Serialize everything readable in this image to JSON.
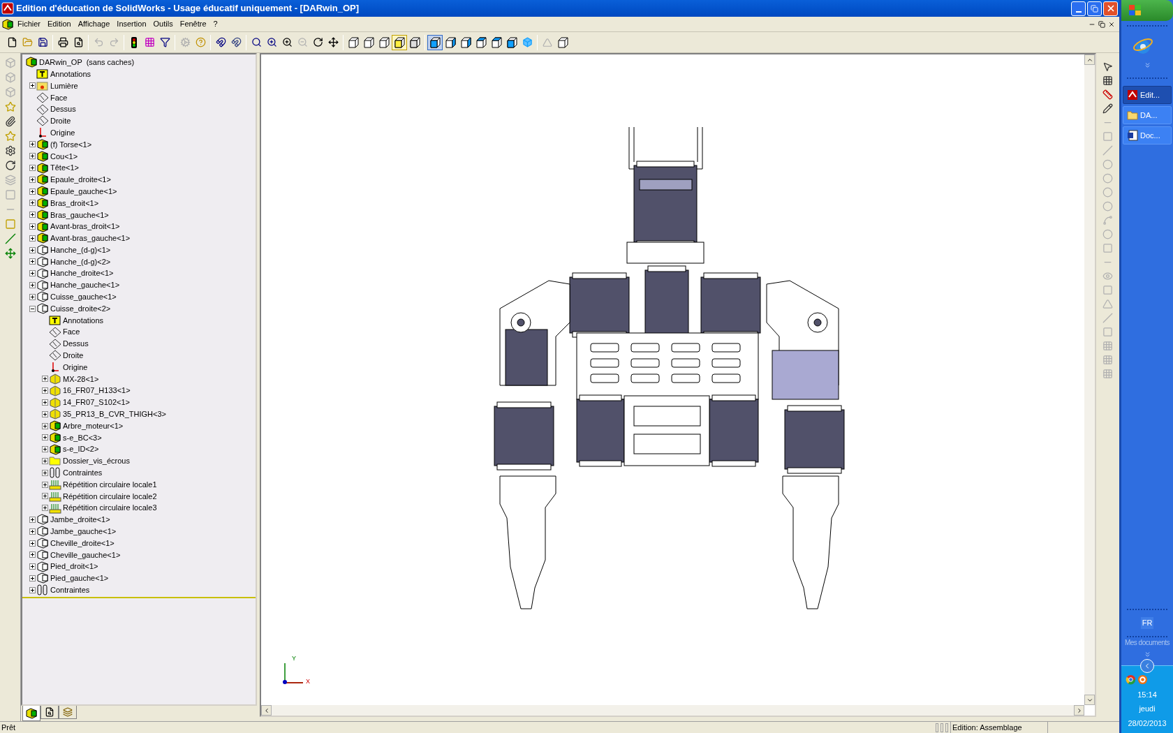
{
  "window": {
    "title": "Edition d'éducation de SolidWorks - Usage éducatif uniquement - [DARwin_OP]"
  },
  "menu": [
    "Fichier",
    "Edition",
    "Affichage",
    "Insertion",
    "Outils",
    "Fenêtre",
    "?"
  ],
  "tree": {
    "label": "DARwin_OP  (sans caches)",
    "kind": "assembly-fixed",
    "children": [
      {
        "label": "Annotations",
        "kind": "annotations"
      },
      {
        "label": "Lumière",
        "kind": "light",
        "expanded": false
      },
      {
        "label": "Face",
        "kind": "plane"
      },
      {
        "label": "Dessus",
        "kind": "plane"
      },
      {
        "label": "Droite",
        "kind": "plane"
      },
      {
        "label": "Origine",
        "kind": "origin"
      },
      {
        "label": "(f) Torse<1>",
        "kind": "assembly-fixed",
        "expanded": false
      },
      {
        "label": "Cou<1>",
        "kind": "assembly-fixed",
        "expanded": false
      },
      {
        "label": "Tête<1>",
        "kind": "assembly-fixed",
        "expanded": false
      },
      {
        "label": "Epaule_droite<1>",
        "kind": "assembly-fixed",
        "expanded": false
      },
      {
        "label": "Epaule_gauche<1>",
        "kind": "assembly-fixed",
        "expanded": false
      },
      {
        "label": "Bras_droit<1>",
        "kind": "assembly-fixed",
        "expanded": false
      },
      {
        "label": "Bras_gauche<1>",
        "kind": "assembly-fixed",
        "expanded": false
      },
      {
        "label": "Avant-bras_droit<1>",
        "kind": "assembly-fixed",
        "expanded": false
      },
      {
        "label": "Avant-bras_gauche<1>",
        "kind": "assembly-fixed",
        "expanded": false
      },
      {
        "label": "Hanche_(d-g)<1>",
        "kind": "assembly",
        "expanded": false
      },
      {
        "label": "Hanche_(d-g)<2>",
        "kind": "assembly",
        "expanded": false
      },
      {
        "label": "Hanche_droite<1>",
        "kind": "assembly",
        "expanded": false
      },
      {
        "label": "Hanche_gauche<1>",
        "kind": "assembly",
        "expanded": false
      },
      {
        "label": "Cuisse_gauche<1>",
        "kind": "assembly",
        "expanded": false
      },
      {
        "label": "Cuisse_droite<2>",
        "kind": "assembly",
        "expanded": true,
        "children": [
          {
            "label": "Annotations",
            "kind": "annotations"
          },
          {
            "label": "Face",
            "kind": "plane"
          },
          {
            "label": "Dessus",
            "kind": "plane"
          },
          {
            "label": "Droite",
            "kind": "plane"
          },
          {
            "label": "Origine",
            "kind": "origin"
          },
          {
            "label": "MX-28<1>",
            "kind": "part",
            "expanded": false
          },
          {
            "label": "16_FR07_H133<1>",
            "kind": "part",
            "expanded": false
          },
          {
            "label": "14_FR07_S102<1>",
            "kind": "part",
            "expanded": false
          },
          {
            "label": "35_PR13_B_CVR_THIGH<3>",
            "kind": "part",
            "expanded": false
          },
          {
            "label": "Arbre_moteur<1>",
            "kind": "assembly-fixed",
            "expanded": false
          },
          {
            "label": "s-e_BC<3>",
            "kind": "assembly-fixed",
            "expanded": false
          },
          {
            "label": "s-e_ID<2>",
            "kind": "assembly-fixed",
            "expanded": false
          },
          {
            "label": "Dossier_vis_écrous",
            "kind": "folder",
            "expanded": false
          },
          {
            "label": "Contraintes",
            "kind": "mates",
            "expanded": false
          },
          {
            "label": "Répétition circulaire locale1",
            "kind": "pattern",
            "expanded": false
          },
          {
            "label": "Répétition circulaire locale2",
            "kind": "pattern",
            "expanded": false
          },
          {
            "label": "Répétition circulaire locale3",
            "kind": "pattern",
            "expanded": false
          }
        ]
      },
      {
        "label": "Jambe_droite<1>",
        "kind": "assembly",
        "expanded": false
      },
      {
        "label": "Jambe_gauche<1>",
        "kind": "assembly",
        "expanded": false
      },
      {
        "label": "Cheville_droite<1>",
        "kind": "assembly",
        "expanded": false
      },
      {
        "label": "Cheville_gauche<1>",
        "kind": "assembly",
        "expanded": false
      },
      {
        "label": "Pied_droit<1>",
        "kind": "assembly",
        "expanded": false
      },
      {
        "label": "Pied_gauche<1>",
        "kind": "assembly",
        "expanded": false
      },
      {
        "label": "Contraintes",
        "kind": "mates",
        "expanded": false
      }
    ]
  },
  "panel_tabs": [
    {
      "kind": "tree",
      "selected": true
    },
    {
      "kind": "properties",
      "selected": false
    },
    {
      "kind": "configurations",
      "selected": false
    }
  ],
  "viewport": {
    "triad": {
      "x": "X",
      "y": "Y"
    }
  },
  "status_bar": {
    "message": "Prêt",
    "mode": "Edition: Assemblage"
  },
  "taskbar": {
    "buttons": [
      {
        "label": "Edit...",
        "kind": "solidworks",
        "selected": true
      },
      {
        "label": "DA...",
        "kind": "folder",
        "selected": false
      },
      {
        "label": "Doc...",
        "kind": "word",
        "selected": false
      }
    ],
    "language": "FR",
    "toolbar_label": "Mes documents",
    "time": "15:14",
    "day": "jeudi",
    "date": "28/02/2013"
  }
}
